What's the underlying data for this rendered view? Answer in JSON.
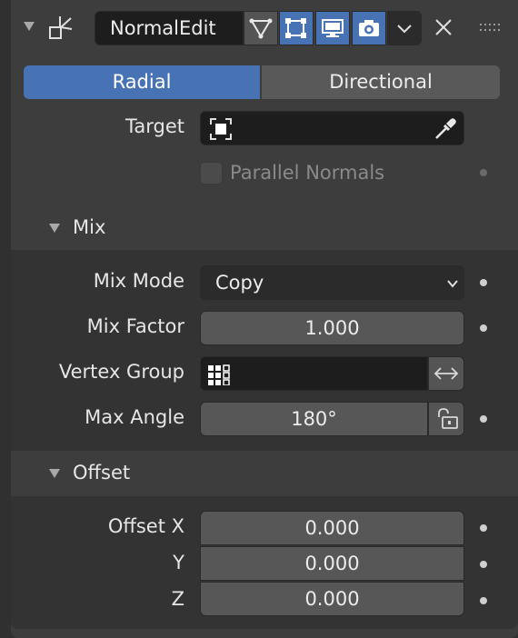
{
  "header": {
    "modifier_name": "NormalEdit",
    "icons": [
      "collapse-triangle-icon",
      "normal-edit-modifier-icon",
      "edit-mode-cage-icon",
      "edit-mode-icon",
      "viewport-display-icon",
      "render-camera-icon",
      "chevron-down-icon",
      "close-icon",
      "drag-handle-icon"
    ]
  },
  "tabs": [
    {
      "label": "Radial",
      "active": true
    },
    {
      "label": "Directional",
      "active": false
    }
  ],
  "target": {
    "label": "Target",
    "value": ""
  },
  "parallel_normals": {
    "label": "Parallel Normals",
    "checked": false
  },
  "mix": {
    "title": "Mix",
    "mode_label": "Mix Mode",
    "mode_value": "Copy",
    "factor_label": "Mix Factor",
    "factor_value": "1.000",
    "vgroup_label": "Vertex Group",
    "vgroup_value": "",
    "angle_label": "Max Angle",
    "angle_value": "180°"
  },
  "offset": {
    "title": "Offset",
    "x_label": "Offset X",
    "x_value": "0.000",
    "y_label": "Y",
    "y_value": "0.000",
    "z_label": "Z",
    "z_value": "0.000"
  },
  "colors": {
    "accent": "#4772b3",
    "panel": "#3d3d3d",
    "field": "#575757",
    "text": "#e6e6e6"
  }
}
